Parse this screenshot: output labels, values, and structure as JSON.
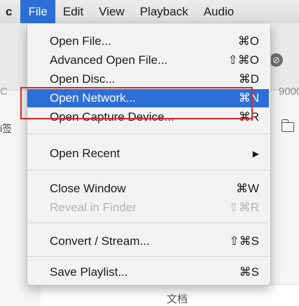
{
  "menubar": {
    "app_label": "c",
    "items": [
      "File",
      "Edit",
      "View",
      "Playback",
      "Audio"
    ]
  },
  "background": {
    "nav_icon": "⊘",
    "address_edge": "C",
    "address_number": "9000",
    "side_text": "i签",
    "bottom_text": "文档"
  },
  "file_menu": {
    "items": [
      {
        "label": "Open File...",
        "shortcut": "⌘O",
        "state": "normal"
      },
      {
        "label": "Advanced Open File...",
        "shortcut": "⇧⌘O",
        "state": "normal"
      },
      {
        "label": "Open Disc...",
        "shortcut": "⌘D",
        "state": "normal"
      },
      {
        "label": "Open Network...",
        "shortcut": "⌘N",
        "state": "selected"
      },
      {
        "label": "Open Capture Device...",
        "shortcut": "⌘R",
        "state": "normal"
      },
      {
        "label": "Open Recent",
        "shortcut": "▶",
        "state": "submenu"
      },
      {
        "label": "Close Window",
        "shortcut": "⌘W",
        "state": "normal"
      },
      {
        "label": "Reveal in Finder",
        "shortcut": "⇧⌘R",
        "state": "disabled"
      },
      {
        "label": "Convert / Stream...",
        "shortcut": "⇧⌘S",
        "state": "normal"
      },
      {
        "label": "Save Playlist...",
        "shortcut": "⌘S",
        "state": "normal"
      }
    ]
  },
  "colors": {
    "selection": "#2d6fd6",
    "highlight_border": "#d62a2a",
    "disabled_text": "#b4b4b4"
  }
}
